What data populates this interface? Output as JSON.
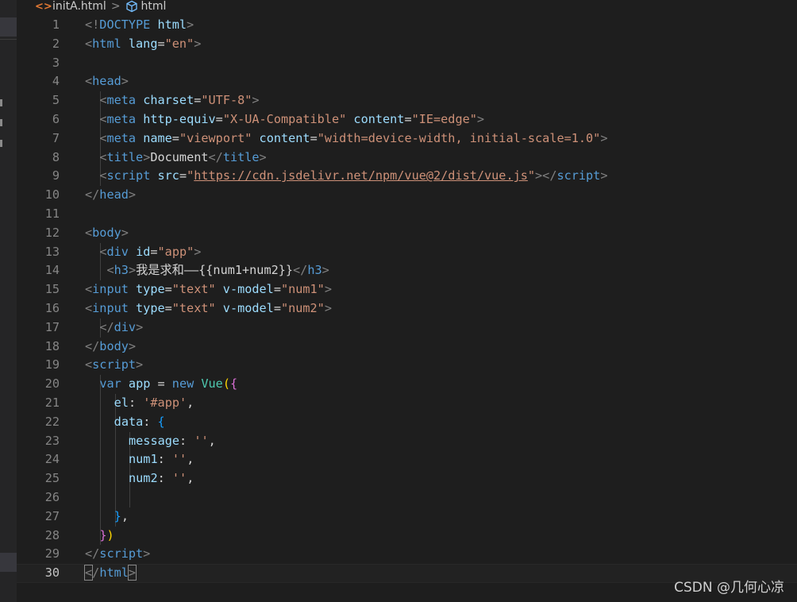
{
  "breadcrumb": {
    "file_icon": "html-file-icon",
    "file": "initA.html",
    "separator": ">",
    "symbol_icon": "cube-symbol-icon",
    "symbol": "html"
  },
  "editor": {
    "language": "html",
    "current_line": 30,
    "lines": [
      {
        "n": "1",
        "indent": 4,
        "tokens": [
          [
            "brk",
            "<!"
          ],
          [
            "tag",
            "DOCTYPE"
          ],
          [
            "txt",
            " "
          ],
          [
            "attr",
            "html"
          ],
          [
            "brk",
            ">"
          ]
        ]
      },
      {
        "n": "2",
        "indent": 4,
        "tokens": [
          [
            "brk",
            "<"
          ],
          [
            "tag",
            "html"
          ],
          [
            "txt",
            " "
          ],
          [
            "attr",
            "lang"
          ],
          [
            "txt",
            "="
          ],
          [
            "str",
            "\"en\""
          ],
          [
            "brk",
            ">"
          ]
        ]
      },
      {
        "n": "3",
        "indent": 0,
        "tokens": []
      },
      {
        "n": "4",
        "indent": 4,
        "tokens": [
          [
            "brk",
            "<"
          ],
          [
            "tag",
            "head"
          ],
          [
            "brk",
            ">"
          ]
        ]
      },
      {
        "n": "5",
        "indent": 6,
        "tokens": [
          [
            "brk",
            "<"
          ],
          [
            "tag",
            "meta"
          ],
          [
            "txt",
            " "
          ],
          [
            "attr",
            "charset"
          ],
          [
            "txt",
            "="
          ],
          [
            "str",
            "\"UTF-8\""
          ],
          [
            "brk",
            ">"
          ]
        ]
      },
      {
        "n": "6",
        "indent": 6,
        "tokens": [
          [
            "brk",
            "<"
          ],
          [
            "tag",
            "meta"
          ],
          [
            "txt",
            " "
          ],
          [
            "attr",
            "http-equiv"
          ],
          [
            "txt",
            "="
          ],
          [
            "str",
            "\"X-UA-Compatible\""
          ],
          [
            "txt",
            " "
          ],
          [
            "attr",
            "content"
          ],
          [
            "txt",
            "="
          ],
          [
            "str",
            "\"IE=edge\""
          ],
          [
            "brk",
            ">"
          ]
        ]
      },
      {
        "n": "7",
        "indent": 6,
        "tokens": [
          [
            "brk",
            "<"
          ],
          [
            "tag",
            "meta"
          ],
          [
            "txt",
            " "
          ],
          [
            "attr",
            "name"
          ],
          [
            "txt",
            "="
          ],
          [
            "str",
            "\"viewport\""
          ],
          [
            "txt",
            " "
          ],
          [
            "attr",
            "content"
          ],
          [
            "txt",
            "="
          ],
          [
            "str",
            "\"width=device-width, initial-scale=1.0\""
          ],
          [
            "brk",
            ">"
          ]
        ]
      },
      {
        "n": "8",
        "indent": 6,
        "tokens": [
          [
            "brk",
            "<"
          ],
          [
            "tag",
            "title"
          ],
          [
            "brk",
            ">"
          ],
          [
            "txt",
            "Document"
          ],
          [
            "brk",
            "</"
          ],
          [
            "tag",
            "title"
          ],
          [
            "brk",
            ">"
          ]
        ]
      },
      {
        "n": "9",
        "indent": 6,
        "tokens": [
          [
            "brk",
            "<"
          ],
          [
            "tag",
            "script"
          ],
          [
            "txt",
            " "
          ],
          [
            "attr",
            "src"
          ],
          [
            "txt",
            "="
          ],
          [
            "str",
            "\""
          ],
          [
            "url",
            "https://cdn.jsdelivr.net/npm/vue@2/dist/vue.js"
          ],
          [
            "str",
            "\""
          ],
          [
            "brk",
            "></"
          ],
          [
            "tag",
            "script"
          ],
          [
            "brk",
            ">"
          ]
        ]
      },
      {
        "n": "10",
        "indent": 4,
        "tokens": [
          [
            "brk",
            "</"
          ],
          [
            "tag",
            "head"
          ],
          [
            "brk",
            ">"
          ]
        ]
      },
      {
        "n": "11",
        "indent": 0,
        "tokens": []
      },
      {
        "n": "12",
        "indent": 4,
        "tokens": [
          [
            "brk",
            "<"
          ],
          [
            "tag",
            "body"
          ],
          [
            "brk",
            ">"
          ]
        ]
      },
      {
        "n": "13",
        "indent": 6,
        "tokens": [
          [
            "brk",
            "<"
          ],
          [
            "tag",
            "div"
          ],
          [
            "txt",
            " "
          ],
          [
            "attr",
            "id"
          ],
          [
            "txt",
            "="
          ],
          [
            "str",
            "\"app\""
          ],
          [
            "brk",
            ">"
          ]
        ]
      },
      {
        "n": "14",
        "indent": 7,
        "tokens": [
          [
            "brk",
            "<"
          ],
          [
            "tag",
            "h3"
          ],
          [
            "brk",
            ">"
          ],
          [
            "txt",
            "我是求和——{{num1+num2}}"
          ],
          [
            "brk",
            "</"
          ],
          [
            "tag",
            "h3"
          ],
          [
            "brk",
            ">"
          ]
        ]
      },
      {
        "n": "15",
        "indent": 4,
        "tokens": [
          [
            "brk",
            "<"
          ],
          [
            "tag",
            "input"
          ],
          [
            "txt",
            " "
          ],
          [
            "attr",
            "type"
          ],
          [
            "txt",
            "="
          ],
          [
            "str",
            "\"text\""
          ],
          [
            "txt",
            " "
          ],
          [
            "attr",
            "v-model"
          ],
          [
            "txt",
            "="
          ],
          [
            "str",
            "\"num1\""
          ],
          [
            "brk",
            ">"
          ]
        ]
      },
      {
        "n": "16",
        "indent": 4,
        "tokens": [
          [
            "brk",
            "<"
          ],
          [
            "tag",
            "input"
          ],
          [
            "txt",
            " "
          ],
          [
            "attr",
            "type"
          ],
          [
            "txt",
            "="
          ],
          [
            "str",
            "\"text\""
          ],
          [
            "txt",
            " "
          ],
          [
            "attr",
            "v-model"
          ],
          [
            "txt",
            "="
          ],
          [
            "str",
            "\"num2\""
          ],
          [
            "brk",
            ">"
          ]
        ]
      },
      {
        "n": "17",
        "indent": 6,
        "tokens": [
          [
            "brk",
            "</"
          ],
          [
            "tag",
            "div"
          ],
          [
            "brk",
            ">"
          ]
        ]
      },
      {
        "n": "18",
        "indent": 4,
        "tokens": [
          [
            "brk",
            "</"
          ],
          [
            "tag",
            "body"
          ],
          [
            "brk",
            ">"
          ]
        ]
      },
      {
        "n": "19",
        "indent": 4,
        "tokens": [
          [
            "brk",
            "<"
          ],
          [
            "tag",
            "script"
          ],
          [
            "brk",
            ">"
          ]
        ]
      },
      {
        "n": "20",
        "indent": 6,
        "tokens": [
          [
            "kw",
            "var"
          ],
          [
            "txt",
            " "
          ],
          [
            "var",
            "app"
          ],
          [
            "txt",
            " = "
          ],
          [
            "kw",
            "new"
          ],
          [
            "txt",
            " "
          ],
          [
            "cls",
            "Vue"
          ],
          [
            "paren",
            "("
          ],
          [
            "brace2",
            "{"
          ]
        ]
      },
      {
        "n": "21",
        "indent": 8,
        "tokens": [
          [
            "var",
            "el"
          ],
          [
            "txt",
            ": "
          ],
          [
            "str",
            "'#app'"
          ],
          [
            "txt",
            ","
          ]
        ]
      },
      {
        "n": "22",
        "indent": 8,
        "tokens": [
          [
            "var",
            "data"
          ],
          [
            "txt",
            ": "
          ],
          [
            "brace3",
            "{"
          ]
        ]
      },
      {
        "n": "23",
        "indent": 10,
        "tokens": [
          [
            "var",
            "message"
          ],
          [
            "txt",
            ": "
          ],
          [
            "str",
            "''"
          ],
          [
            "txt",
            ","
          ]
        ]
      },
      {
        "n": "24",
        "indent": 10,
        "tokens": [
          [
            "var",
            "num1"
          ],
          [
            "txt",
            ": "
          ],
          [
            "str",
            "''"
          ],
          [
            "txt",
            ","
          ]
        ]
      },
      {
        "n": "25",
        "indent": 10,
        "tokens": [
          [
            "var",
            "num2"
          ],
          [
            "txt",
            ": "
          ],
          [
            "str",
            "''"
          ],
          [
            "txt",
            ","
          ]
        ]
      },
      {
        "n": "26",
        "indent": 0,
        "tokens": []
      },
      {
        "n": "27",
        "indent": 8,
        "tokens": [
          [
            "brace3",
            "}"
          ],
          [
            "txt",
            ","
          ]
        ]
      },
      {
        "n": "28",
        "indent": 6,
        "tokens": [
          [
            "brace2",
            "}"
          ],
          [
            "paren",
            ")"
          ]
        ]
      },
      {
        "n": "29",
        "indent": 4,
        "tokens": [
          [
            "brk",
            "</"
          ],
          [
            "tag",
            "script"
          ],
          [
            "brk",
            ">"
          ]
        ]
      },
      {
        "n": "30",
        "indent": 4,
        "tokens": [
          [
            "bm",
            "<"
          ],
          [
            "brk",
            "/"
          ],
          [
            "tag",
            "html"
          ],
          [
            "bm",
            ">"
          ]
        ]
      }
    ]
  },
  "watermark": "CSDN @几何心凉"
}
